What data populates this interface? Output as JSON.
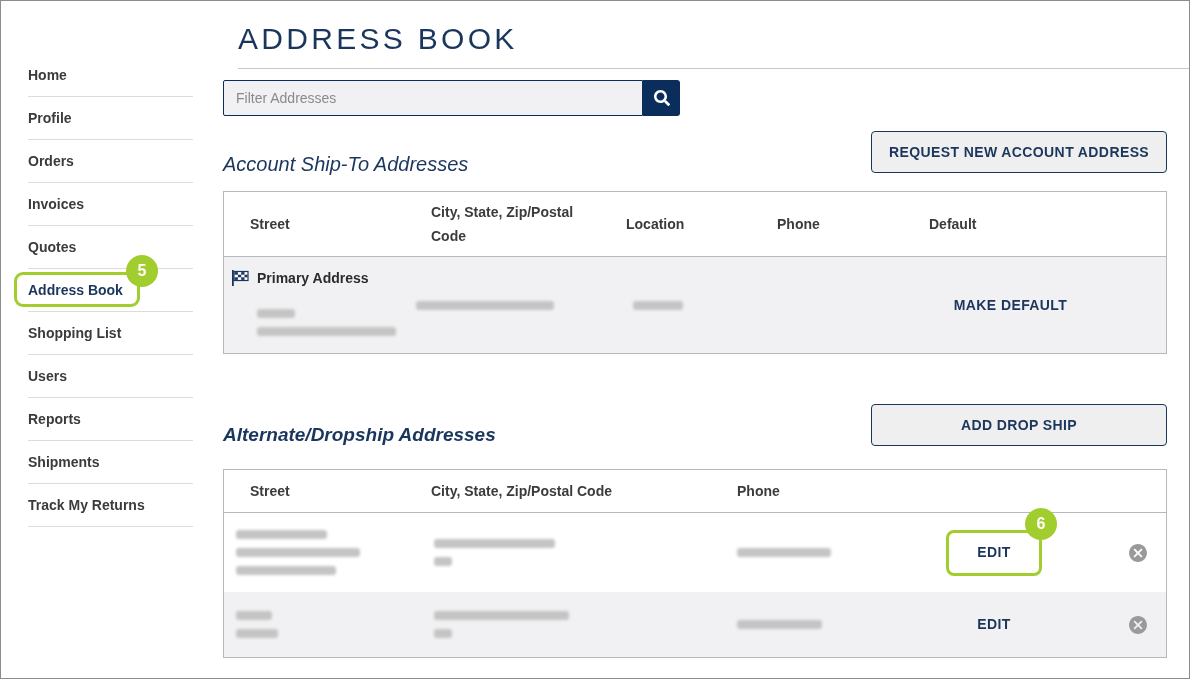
{
  "sidebar": {
    "items": [
      {
        "label": "Home",
        "selected": false
      },
      {
        "label": "Profile",
        "selected": false
      },
      {
        "label": "Orders",
        "selected": false
      },
      {
        "label": "Invoices",
        "selected": false
      },
      {
        "label": "Quotes",
        "selected": false
      },
      {
        "label": "Address Book",
        "selected": true,
        "callout": "5"
      },
      {
        "label": "Shopping List",
        "selected": false
      },
      {
        "label": "Users",
        "selected": false
      },
      {
        "label": "Reports",
        "selected": false
      },
      {
        "label": "Shipments",
        "selected": false
      },
      {
        "label": "Track My Returns",
        "selected": false
      }
    ]
  },
  "page_title": "ADDRESS BOOK",
  "search": {
    "placeholder": "Filter Addresses"
  },
  "account_section": {
    "heading": "Account Ship-To Addresses",
    "button": "REQUEST NEW ACCOUNT ADDRESS",
    "table": {
      "columns": [
        "Street",
        "City, State, Zip/Postal Code",
        "Location",
        "Phone",
        "Default"
      ],
      "rows": [
        {
          "label": "Primary Address",
          "action": "MAKE DEFAULT"
        }
      ]
    }
  },
  "dropship_section": {
    "heading": "Alternate/Dropship Addresses",
    "button": "ADD DROP SHIP",
    "table": {
      "columns": [
        "Street",
        "City, State, Zip/Postal Code",
        "Phone"
      ],
      "rows": [
        {
          "action": "EDIT",
          "callout": "6"
        },
        {
          "action": "EDIT"
        }
      ]
    }
  }
}
